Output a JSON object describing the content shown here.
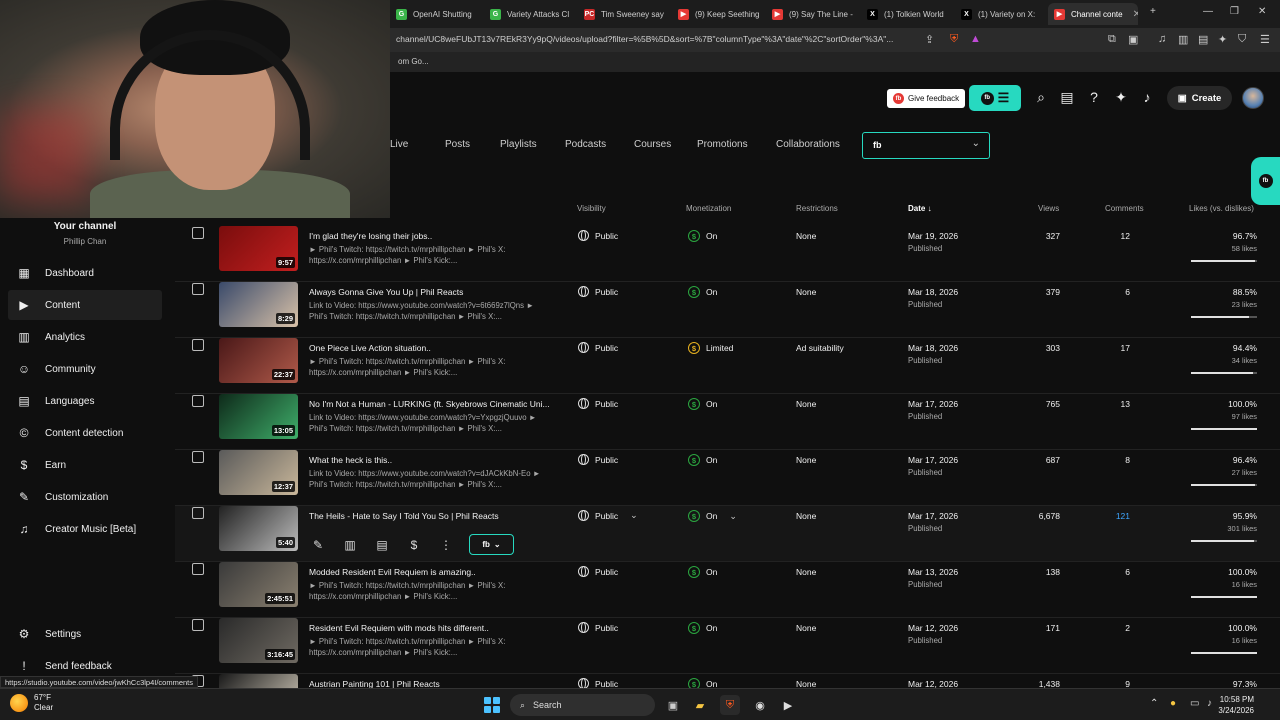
{
  "browser": {
    "tabs": [
      {
        "label": "OpenAI Shutting",
        "fav": "G",
        "color": "#3bb54a"
      },
      {
        "label": "Variety Attacks Cl",
        "fav": "G",
        "color": "#3bb54a"
      },
      {
        "label": "Tim Sweeney say",
        "fav": "PC",
        "color": "#c62828"
      },
      {
        "label": "(9) Keep Seething",
        "fav": "▶",
        "color": "#e53935"
      },
      {
        "label": "(9) Say The Line -",
        "fav": "▶",
        "color": "#e53935"
      },
      {
        "label": "(1) Tolkien World",
        "fav": "X",
        "color": "#000000"
      },
      {
        "label": "(1) Variety on X:",
        "fav": "X",
        "color": "#000000"
      },
      {
        "label": "Channel conte",
        "fav": "▶",
        "color": "#e53935"
      }
    ],
    "url": "channel/UC8weFUbJT13v7REkR3Yy9pQ/videos/upload?filter=%5B%5D&sort=%7B\"columnType\"%3A\"date\"%2C\"sortOrder\"%3A\"...",
    "bookmark": "om Go..."
  },
  "header": {
    "feedback_label": "Give feedback",
    "ext_badge": "fb",
    "create_label": "Create"
  },
  "tabs": [
    "Live",
    "Posts",
    "Playlists",
    "Podcasts",
    "Courses",
    "Promotions",
    "Collaborations"
  ],
  "ext_select_label": "fb",
  "sidebar": {
    "channel_title": "Your channel",
    "channel_name": "Phillip Chan",
    "items": [
      {
        "label": "Dashboard",
        "icon": "dashboard-icon",
        "glyph": "▦"
      },
      {
        "label": "Content",
        "icon": "content-icon",
        "glyph": "▶"
      },
      {
        "label": "Analytics",
        "icon": "analytics-icon",
        "glyph": "▥"
      },
      {
        "label": "Community",
        "icon": "community-icon",
        "glyph": "☺"
      },
      {
        "label": "Languages",
        "icon": "languages-icon",
        "glyph": "▤"
      },
      {
        "label": "Content detection",
        "icon": "copyright-icon",
        "glyph": "©"
      },
      {
        "label": "Earn",
        "icon": "earn-icon",
        "glyph": "$"
      },
      {
        "label": "Customization",
        "icon": "customization-icon",
        "glyph": "✎"
      },
      {
        "label": "Creator Music [Beta]",
        "icon": "music-icon",
        "glyph": "♫"
      }
    ],
    "settings_label": "Settings",
    "feedback_label": "Send feedback"
  },
  "table": {
    "headers": {
      "visibility": "Visibility",
      "monetization": "Monetization",
      "restrictions": "Restrictions",
      "date": "Date",
      "views": "Views",
      "comments": "Comments",
      "likes": "Likes (vs. dislikes)"
    },
    "rows": [
      {
        "title": "I'm glad they're losing their jobs..",
        "desc": "► Phil's Twitch: https://twitch.tv/mrphillipchan ► Phil's X: https://x.com/mrphillipchan ► Phil's Kick:...",
        "duration": "9:57",
        "visibility": "Public",
        "monetization": "On",
        "mon_limited": false,
        "restrictions": "None",
        "date": "Mar 19, 2026",
        "status": "Published",
        "views": "327",
        "comments": "12",
        "likes_pct": "96.7%",
        "likes_count": "58 likes",
        "likes_ratio": 0.967,
        "thumb": [
          "#7a0d0d",
          "#c21f1f"
        ]
      },
      {
        "title": "Always Gonna Give You Up | Phil Reacts",
        "desc": "Link to Video: https://www.youtube.com/watch?v=6t669z7lQns ► Phil's Twitch: https://twitch.tv/mrphillipchan ► Phil's X:...",
        "duration": "8:29",
        "visibility": "Public",
        "monetization": "On",
        "mon_limited": false,
        "restrictions": "None",
        "date": "Mar 18, 2026",
        "status": "Published",
        "views": "379",
        "comments": "6",
        "likes_pct": "88.5%",
        "likes_count": "23 likes",
        "likes_ratio": 0.885,
        "thumb": [
          "#3a4a6a",
          "#d9c2a8"
        ]
      },
      {
        "title": "One Piece Live Action situation..",
        "desc": "► Phil's Twitch: https://twitch.tv/mrphillipchan ► Phil's X: https://x.com/mrphillipchan ► Phil's Kick:...",
        "duration": "22:37",
        "visibility": "Public",
        "monetization": "Limited",
        "mon_limited": true,
        "restrictions": "Ad suitability",
        "date": "Mar 18, 2026",
        "status": "Published",
        "views": "303",
        "comments": "17",
        "likes_pct": "94.4%",
        "likes_count": "34 likes",
        "likes_ratio": 0.944,
        "thumb": [
          "#4a1818",
          "#b05a4a"
        ]
      },
      {
        "title": "No I'm Not a Human - LURKING (ft. Skyebrows Cinematic Uni...",
        "desc": "Link to Video: https://www.youtube.com/watch?v=YxpgzjQuuvo ► Phil's Twitch: https://twitch.tv/mrphillipchan ► Phil's X:...",
        "duration": "13:05",
        "visibility": "Public",
        "monetization": "On",
        "mon_limited": false,
        "restrictions": "None",
        "date": "Mar 17, 2026",
        "status": "Published",
        "views": "765",
        "comments": "13",
        "likes_pct": "100.0%",
        "likes_count": "97 likes",
        "likes_ratio": 1.0,
        "thumb": [
          "#0e2a1a",
          "#3fae6a"
        ]
      },
      {
        "title": "What the heck is this..",
        "desc": "Link to Video: https://www.youtube.com/watch?v=dJACkKbN-Eo ► Phil's Twitch: https://twitch.tv/mrphillipchan ► Phil's X:...",
        "duration": "12:37",
        "visibility": "Public",
        "monetization": "On",
        "mon_limited": false,
        "restrictions": "None",
        "date": "Mar 17, 2026",
        "status": "Published",
        "views": "687",
        "comments": "8",
        "likes_pct": "96.4%",
        "likes_count": "27 likes",
        "likes_ratio": 0.964,
        "thumb": [
          "#5a5a5a",
          "#c9b79a"
        ]
      },
      {
        "title": "The Heils - Hate to Say I Told You So | Phil Reacts",
        "desc": "",
        "duration": "5:40",
        "visibility": "Public",
        "monetization": "On",
        "mon_limited": false,
        "restrictions": "None",
        "date": "Mar 17, 2026",
        "status": "Published",
        "views": "6,678",
        "comments": "121",
        "likes_pct": "95.9%",
        "likes_count": "301 likes",
        "likes_ratio": 0.959,
        "thumb": [
          "#222222",
          "#bdbdbd"
        ],
        "hover": true
      },
      {
        "title": "Modded Resident Evil Requiem is amazing..",
        "desc": "► Phil's Twitch: https://twitch.tv/mrphillipchan ► Phil's X: https://x.com/mrphillipchan ► Phil's Kick:...",
        "duration": "2:45:51",
        "visibility": "Public",
        "monetization": "On",
        "mon_limited": false,
        "restrictions": "None",
        "date": "Mar 13, 2026",
        "status": "Published",
        "views": "138",
        "comments": "6",
        "likes_pct": "100.0%",
        "likes_count": "16 likes",
        "likes_ratio": 1.0,
        "thumb": [
          "#3a3a3a",
          "#8a8070"
        ]
      },
      {
        "title": "Resident Evil Requiem with mods hits different..",
        "desc": "► Phil's Twitch: https://twitch.tv/mrphillipchan ► Phil's X: https://x.com/mrphillipchan ► Phil's Kick:...",
        "duration": "3:16:45",
        "visibility": "Public",
        "monetization": "On",
        "mon_limited": false,
        "restrictions": "None",
        "date": "Mar 12, 2026",
        "status": "Published",
        "views": "171",
        "comments": "2",
        "likes_pct": "100.0%",
        "likes_count": "16 likes",
        "likes_ratio": 1.0,
        "thumb": [
          "#2a2a2a",
          "#6f6a62"
        ]
      },
      {
        "title": "Austrian Painting 101 | Phil Reacts",
        "desc": "",
        "duration": "",
        "visibility": "Public",
        "monetization": "On",
        "mon_limited": false,
        "restrictions": "None",
        "date": "Mar 12, 2026",
        "status": "Published",
        "views": "1,438",
        "comments": "9",
        "likes_pct": "97.3%",
        "likes_count": "",
        "likes_ratio": 0.973,
        "thumb": [
          "#1a1a1a",
          "#d8d0c0"
        ]
      }
    ]
  },
  "status_url": "https://studio.youtube.com/video/jwKhCc3lp4I/comments",
  "taskbar": {
    "temp": "67°F",
    "weather": "Clear",
    "search_label": "Search",
    "time": "10:58 PM",
    "date": "3/24/2026"
  }
}
